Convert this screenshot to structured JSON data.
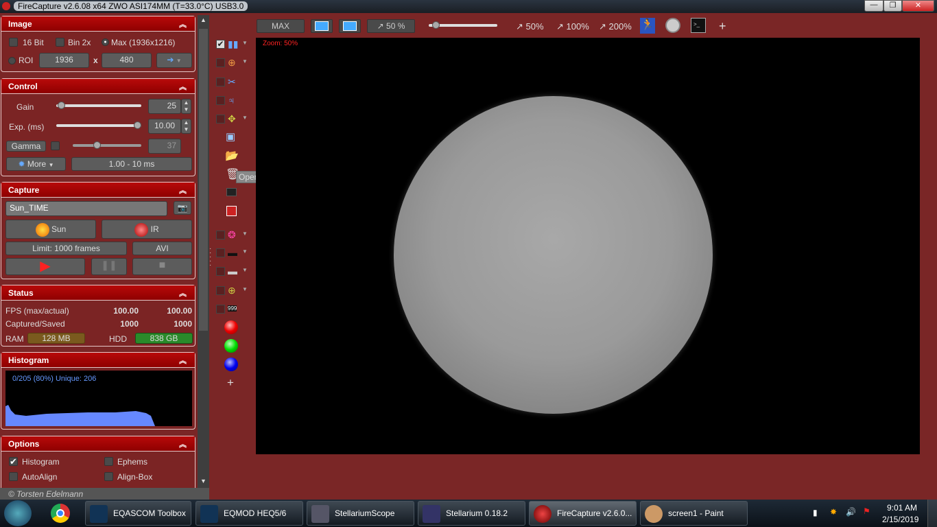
{
  "window": {
    "title": "FireCapture v2.6.08  x64     ZWO ASI174MM (T=33.0°C) USB3.0",
    "min": "—",
    "max": "❐",
    "close": "✕"
  },
  "image_panel": {
    "title": "Image",
    "bit16": "16 Bit",
    "bin2x": "Bin 2x",
    "max": "Max (1936x1216)",
    "roi": "ROI",
    "width": "1936",
    "x": "x",
    "height": "480"
  },
  "control_panel": {
    "title": "Control",
    "gain_label": "Gain",
    "gain": "25",
    "gain_level": 0.02,
    "exp_label": "Exp. (ms)",
    "exp": "10.00",
    "exp_level": 1.0,
    "gamma_label": "Gamma",
    "gamma": "37",
    "more": "More",
    "range": "1.00 - 10 ms"
  },
  "capture_panel": {
    "title": "Capture",
    "profile": "Sun_TIME",
    "sun": "Sun",
    "ir": "IR",
    "limit": "Limit: 1000 frames",
    "format": "AVI"
  },
  "status_panel": {
    "title": "Status",
    "fps_label": "FPS (max/actual)",
    "fps_max": "100.00",
    "fps_actual": "100.00",
    "cap_label": "Captured/Saved",
    "captured": "1000",
    "saved": "1000",
    "ram_label": "RAM",
    "ram": "128 MB",
    "hdd_label": "HDD",
    "hdd": "838 GB"
  },
  "histogram_panel": {
    "title": "Histogram",
    "info": "0/205 (80%)  Unique: 206"
  },
  "options_panel": {
    "title": "Options",
    "histogram": "Histogram",
    "ephems": "Ephems",
    "autoalign": "AutoAlign",
    "alignbox": "Align-Box"
  },
  "footer": {
    "copyright": "© Torsten Edelmann"
  },
  "toolbar": {
    "max": "MAX",
    "zoom": "50 %",
    "z50": "50%",
    "z100": "100%",
    "z200": "200%",
    "plus": "+"
  },
  "viewer": {
    "zoom_label": "Zoom: 50%"
  },
  "tooltip": "Open capture folder",
  "tools": {
    "plus": "+"
  },
  "taskbar": {
    "items": [
      "EQASCOM Toolbox",
      "EQMOD HEQ5/6",
      "StellariumScope",
      "Stellarium 0.18.2",
      "FireCapture v2.6.0...",
      "screen1 - Paint"
    ],
    "time": "9:01 AM",
    "date": "2/15/2019"
  }
}
